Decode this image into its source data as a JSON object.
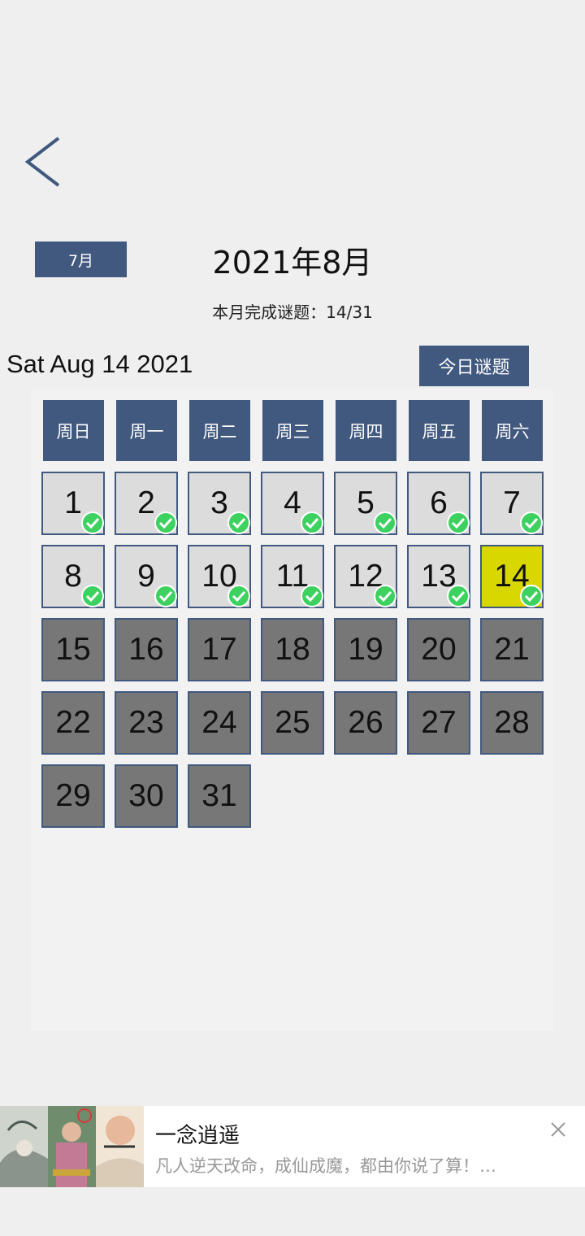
{
  "header": {
    "back_icon": "chevron-left-icon",
    "prev_month_label": "7月",
    "month_title": "2021年8月",
    "progress_text": "本月完成谜题：14/31",
    "date_string": "Sat Aug 14 2021",
    "today_button_label": "今日谜题"
  },
  "calendar": {
    "weekdays": [
      "周日",
      "周一",
      "周二",
      "周三",
      "周四",
      "周五",
      "周六"
    ],
    "days": [
      {
        "label": "1",
        "status": "done"
      },
      {
        "label": "2",
        "status": "done"
      },
      {
        "label": "3",
        "status": "done"
      },
      {
        "label": "4",
        "status": "done"
      },
      {
        "label": "5",
        "status": "done"
      },
      {
        "label": "6",
        "status": "done"
      },
      {
        "label": "7",
        "status": "done"
      },
      {
        "label": "8",
        "status": "done"
      },
      {
        "label": "9",
        "status": "done"
      },
      {
        "label": "10",
        "status": "done"
      },
      {
        "label": "11",
        "status": "done"
      },
      {
        "label": "12",
        "status": "done"
      },
      {
        "label": "13",
        "status": "done"
      },
      {
        "label": "14",
        "status": "today-done"
      },
      {
        "label": "15",
        "status": "future"
      },
      {
        "label": "16",
        "status": "future"
      },
      {
        "label": "17",
        "status": "future"
      },
      {
        "label": "18",
        "status": "future"
      },
      {
        "label": "19",
        "status": "future"
      },
      {
        "label": "20",
        "status": "future"
      },
      {
        "label": "21",
        "status": "future"
      },
      {
        "label": "22",
        "status": "future"
      },
      {
        "label": "23",
        "status": "future"
      },
      {
        "label": "24",
        "status": "future"
      },
      {
        "label": "25",
        "status": "future"
      },
      {
        "label": "26",
        "status": "future"
      },
      {
        "label": "27",
        "status": "future"
      },
      {
        "label": "28",
        "status": "future"
      },
      {
        "label": "29",
        "status": "future"
      },
      {
        "label": "30",
        "status": "future"
      },
      {
        "label": "31",
        "status": "future"
      }
    ],
    "colors": {
      "accent": "#41597f",
      "done_bg": "#dcdcdc",
      "today_bg": "#d9d700",
      "future_bg": "#777777",
      "check_green": "#3dd15f"
    }
  },
  "ad": {
    "title": "一念逍遥",
    "description": "凡人逆天改命，成仙成魔，都由你说了算！…",
    "close_icon": "close-icon"
  }
}
